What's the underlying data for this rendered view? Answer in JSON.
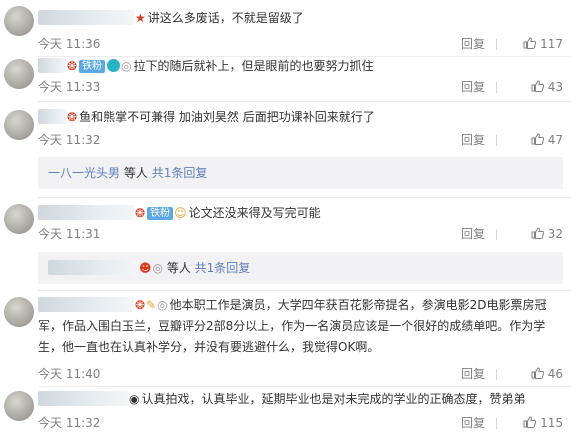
{
  "comments": [
    {
      "text": "讲这么多废话，不就是留级了",
      "time": "今天 11:36",
      "reply": "回复",
      "likes": "117"
    },
    {
      "fan_badge": "铁粉",
      "text": "拉下的随后就补上，但是眼前的也要努力抓住",
      "time": "今天 11:33",
      "reply": "回复",
      "likes": "43"
    },
    {
      "text": "鱼和熊掌不可兼得 加油刘昊然 后面把功课补回来就行了",
      "time": "今天 11:32",
      "reply": "回复",
      "likes": "47",
      "sub": {
        "user": "一八一光头男",
        "middle": "等人",
        "count": "共1条回复"
      }
    },
    {
      "fan_badge": "铁粉",
      "text": "论文还没来得及写完可能",
      "time": "今天 11:31",
      "reply": "回复",
      "likes": "32",
      "sub": {
        "middle": "等人",
        "count": "共1条回复"
      }
    },
    {
      "text": "他本职工作是演员，大学四年获百花影帝提名，参演电影2D电影票房冠军，作品入围白玉兰，豆瓣评分2部8分以上，作为一名演员应该是一个很好的成绩单吧。作为学生，他一直也在认真补学分，并没有要逃避什么，我觉得OK啊。",
      "time": "今天 11:40",
      "reply": "回复",
      "likes": "46"
    },
    {
      "text": "认真拍戏，认真毕业，延期毕业也是对未完成的学业的正确态度，赞弟弟",
      "time": "今天 11:32",
      "reply": "回复",
      "likes": "115"
    }
  ],
  "icons": {
    "thumb": "thumbs-up-icon",
    "star": "red-star-icon",
    "verified": "verified-badge-icon"
  },
  "colors": {
    "link": "#5d7fbf",
    "fan_badge": "#5aa9e6",
    "meta": "#808080"
  }
}
